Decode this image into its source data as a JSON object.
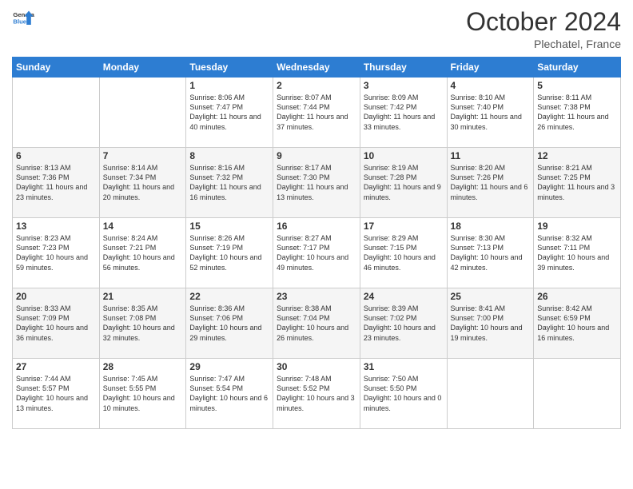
{
  "header": {
    "logo_general": "General",
    "logo_blue": "Blue",
    "month": "October 2024",
    "location": "Plechatel, France"
  },
  "days_of_week": [
    "Sunday",
    "Monday",
    "Tuesday",
    "Wednesday",
    "Thursday",
    "Friday",
    "Saturday"
  ],
  "weeks": [
    [
      {
        "day": "",
        "content": ""
      },
      {
        "day": "",
        "content": ""
      },
      {
        "day": "1",
        "content": "Sunrise: 8:06 AM\nSunset: 7:47 PM\nDaylight: 11 hours and 40 minutes."
      },
      {
        "day": "2",
        "content": "Sunrise: 8:07 AM\nSunset: 7:44 PM\nDaylight: 11 hours and 37 minutes."
      },
      {
        "day": "3",
        "content": "Sunrise: 8:09 AM\nSunset: 7:42 PM\nDaylight: 11 hours and 33 minutes."
      },
      {
        "day": "4",
        "content": "Sunrise: 8:10 AM\nSunset: 7:40 PM\nDaylight: 11 hours and 30 minutes."
      },
      {
        "day": "5",
        "content": "Sunrise: 8:11 AM\nSunset: 7:38 PM\nDaylight: 11 hours and 26 minutes."
      }
    ],
    [
      {
        "day": "6",
        "content": "Sunrise: 8:13 AM\nSunset: 7:36 PM\nDaylight: 11 hours and 23 minutes."
      },
      {
        "day": "7",
        "content": "Sunrise: 8:14 AM\nSunset: 7:34 PM\nDaylight: 11 hours and 20 minutes."
      },
      {
        "day": "8",
        "content": "Sunrise: 8:16 AM\nSunset: 7:32 PM\nDaylight: 11 hours and 16 minutes."
      },
      {
        "day": "9",
        "content": "Sunrise: 8:17 AM\nSunset: 7:30 PM\nDaylight: 11 hours and 13 minutes."
      },
      {
        "day": "10",
        "content": "Sunrise: 8:19 AM\nSunset: 7:28 PM\nDaylight: 11 hours and 9 minutes."
      },
      {
        "day": "11",
        "content": "Sunrise: 8:20 AM\nSunset: 7:26 PM\nDaylight: 11 hours and 6 minutes."
      },
      {
        "day": "12",
        "content": "Sunrise: 8:21 AM\nSunset: 7:25 PM\nDaylight: 11 hours and 3 minutes."
      }
    ],
    [
      {
        "day": "13",
        "content": "Sunrise: 8:23 AM\nSunset: 7:23 PM\nDaylight: 10 hours and 59 minutes."
      },
      {
        "day": "14",
        "content": "Sunrise: 8:24 AM\nSunset: 7:21 PM\nDaylight: 10 hours and 56 minutes."
      },
      {
        "day": "15",
        "content": "Sunrise: 8:26 AM\nSunset: 7:19 PM\nDaylight: 10 hours and 52 minutes."
      },
      {
        "day": "16",
        "content": "Sunrise: 8:27 AM\nSunset: 7:17 PM\nDaylight: 10 hours and 49 minutes."
      },
      {
        "day": "17",
        "content": "Sunrise: 8:29 AM\nSunset: 7:15 PM\nDaylight: 10 hours and 46 minutes."
      },
      {
        "day": "18",
        "content": "Sunrise: 8:30 AM\nSunset: 7:13 PM\nDaylight: 10 hours and 42 minutes."
      },
      {
        "day": "19",
        "content": "Sunrise: 8:32 AM\nSunset: 7:11 PM\nDaylight: 10 hours and 39 minutes."
      }
    ],
    [
      {
        "day": "20",
        "content": "Sunrise: 8:33 AM\nSunset: 7:09 PM\nDaylight: 10 hours and 36 minutes."
      },
      {
        "day": "21",
        "content": "Sunrise: 8:35 AM\nSunset: 7:08 PM\nDaylight: 10 hours and 32 minutes."
      },
      {
        "day": "22",
        "content": "Sunrise: 8:36 AM\nSunset: 7:06 PM\nDaylight: 10 hours and 29 minutes."
      },
      {
        "day": "23",
        "content": "Sunrise: 8:38 AM\nSunset: 7:04 PM\nDaylight: 10 hours and 26 minutes."
      },
      {
        "day": "24",
        "content": "Sunrise: 8:39 AM\nSunset: 7:02 PM\nDaylight: 10 hours and 23 minutes."
      },
      {
        "day": "25",
        "content": "Sunrise: 8:41 AM\nSunset: 7:00 PM\nDaylight: 10 hours and 19 minutes."
      },
      {
        "day": "26",
        "content": "Sunrise: 8:42 AM\nSunset: 6:59 PM\nDaylight: 10 hours and 16 minutes."
      }
    ],
    [
      {
        "day": "27",
        "content": "Sunrise: 7:44 AM\nSunset: 5:57 PM\nDaylight: 10 hours and 13 minutes."
      },
      {
        "day": "28",
        "content": "Sunrise: 7:45 AM\nSunset: 5:55 PM\nDaylight: 10 hours and 10 minutes."
      },
      {
        "day": "29",
        "content": "Sunrise: 7:47 AM\nSunset: 5:54 PM\nDaylight: 10 hours and 6 minutes."
      },
      {
        "day": "30",
        "content": "Sunrise: 7:48 AM\nSunset: 5:52 PM\nDaylight: 10 hours and 3 minutes."
      },
      {
        "day": "31",
        "content": "Sunrise: 7:50 AM\nSunset: 5:50 PM\nDaylight: 10 hours and 0 minutes."
      },
      {
        "day": "",
        "content": ""
      },
      {
        "day": "",
        "content": ""
      }
    ]
  ]
}
